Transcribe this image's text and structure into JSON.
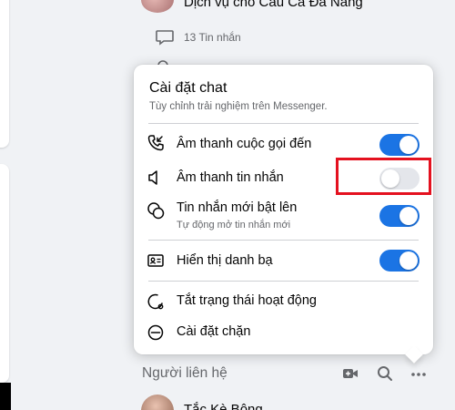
{
  "background": {
    "group_title": "Dịch vụ cho Câu Cá Đà Nẵng",
    "message_count": "13 Tin nhắn"
  },
  "popup": {
    "title": "Cài đặt chat",
    "subtitle": "Tùy chỉnh trải nghiệm trên Messenger.",
    "items": [
      {
        "label": "Âm thanh cuộc gọi đến",
        "icon": "phone-incoming-icon",
        "toggle": true
      },
      {
        "label": "Âm thanh tin nhắn",
        "icon": "speaker-icon",
        "toggle": false
      },
      {
        "label": "Tin nhắn mới bật lên",
        "sub": "Tự động mở tin nhắn mới",
        "icon": "chat-bubbles-icon",
        "toggle": true
      },
      {
        "label": "Hiển thị danh bạ",
        "icon": "contact-card-icon",
        "toggle": true
      },
      {
        "label": "Tắt trạng thái hoạt động",
        "icon": "active-status-icon"
      },
      {
        "label": "Cài đặt chặn",
        "icon": "block-icon"
      }
    ]
  },
  "contacts": {
    "title": "Người liên hệ",
    "first_contact": "Tắc Kè Bông"
  },
  "colors": {
    "toggle_on": "#1b74e4",
    "toggle_off": "#e4e6eb",
    "highlight": "#e4111f"
  }
}
